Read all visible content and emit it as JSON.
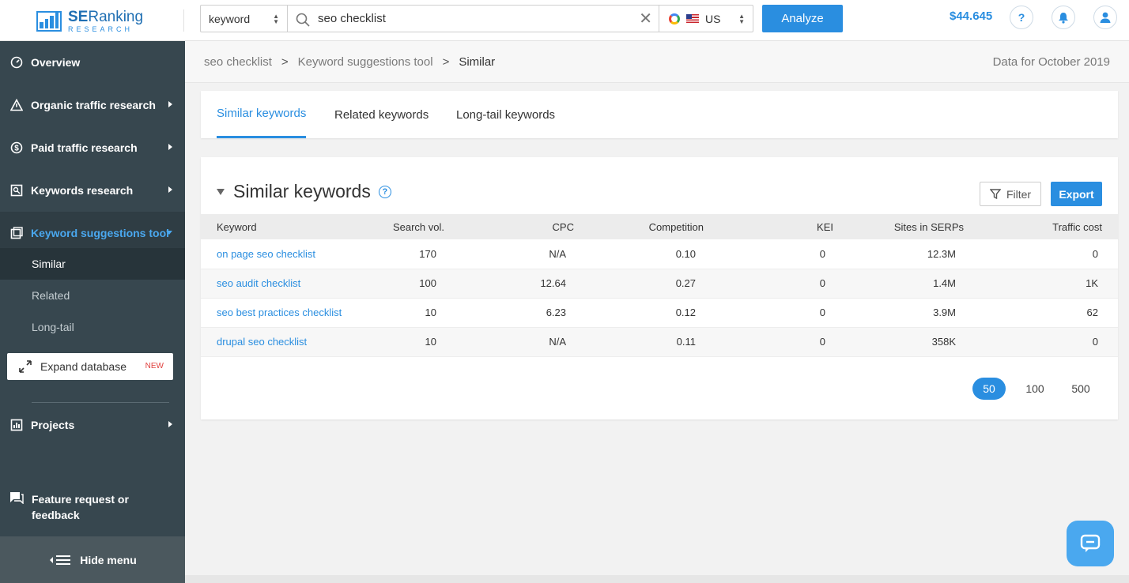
{
  "header": {
    "logo_top": "SE",
    "logo_top_bold": "Ranking",
    "logo_bottom": "RESEARCH",
    "search_mode": "keyword",
    "search_query": "seo checklist",
    "region": "US",
    "analyze_label": "Analyze",
    "balance": "$44.645",
    "help_label": "?"
  },
  "sidebar": {
    "items": [
      {
        "label": "Overview",
        "icon": "gauge-icon"
      },
      {
        "label": "Organic traffic research",
        "icon": "warning-triangle-icon"
      },
      {
        "label": "Paid traffic research",
        "icon": "dollar-icon"
      },
      {
        "label": "Keywords research",
        "icon": "keyword-image-icon"
      },
      {
        "label": "Keyword suggestions tool",
        "icon": "suggestions-icon"
      }
    ],
    "sub_items": [
      "Similar",
      "Related",
      "Long-tail"
    ],
    "expand_db_label": "Expand database",
    "expand_db_badge": "NEW",
    "projects_label": "Projects",
    "feedback_label": "Feature request or feedback",
    "hide_menu_label": "Hide menu"
  },
  "breadcrumb": {
    "items": [
      "seo checklist",
      "Keyword suggestions tool",
      "Similar"
    ],
    "data_for": "Data for October 2019"
  },
  "tabs": [
    "Similar keywords",
    "Related keywords",
    "Long-tail keywords"
  ],
  "table_card": {
    "title": "Similar keywords",
    "filter_label": "Filter",
    "export_label": "Export",
    "columns": [
      "Keyword",
      "Search vol.",
      "CPC",
      "Competition",
      "KEI",
      "Sites in SERPs",
      "Traffic cost"
    ],
    "rows": [
      [
        "on page seo checklist",
        "170",
        "N/A",
        "0.10",
        "0",
        "12.3M",
        "0"
      ],
      [
        "seo audit checklist",
        "100",
        "12.64",
        "0.27",
        "0",
        "1.4M",
        "1K"
      ],
      [
        "seo best practices checklist",
        "10",
        "6.23",
        "0.12",
        "0",
        "3.9M",
        "62"
      ],
      [
        "drupal seo checklist",
        "10",
        "N/A",
        "0.11",
        "0",
        "358K",
        "0"
      ]
    ],
    "page_sizes": [
      "50",
      "100",
      "500"
    ]
  },
  "colors": {
    "accent": "#2a8ee0",
    "sidebar_bg": "#37474f",
    "badge_red": "#e0413e"
  }
}
